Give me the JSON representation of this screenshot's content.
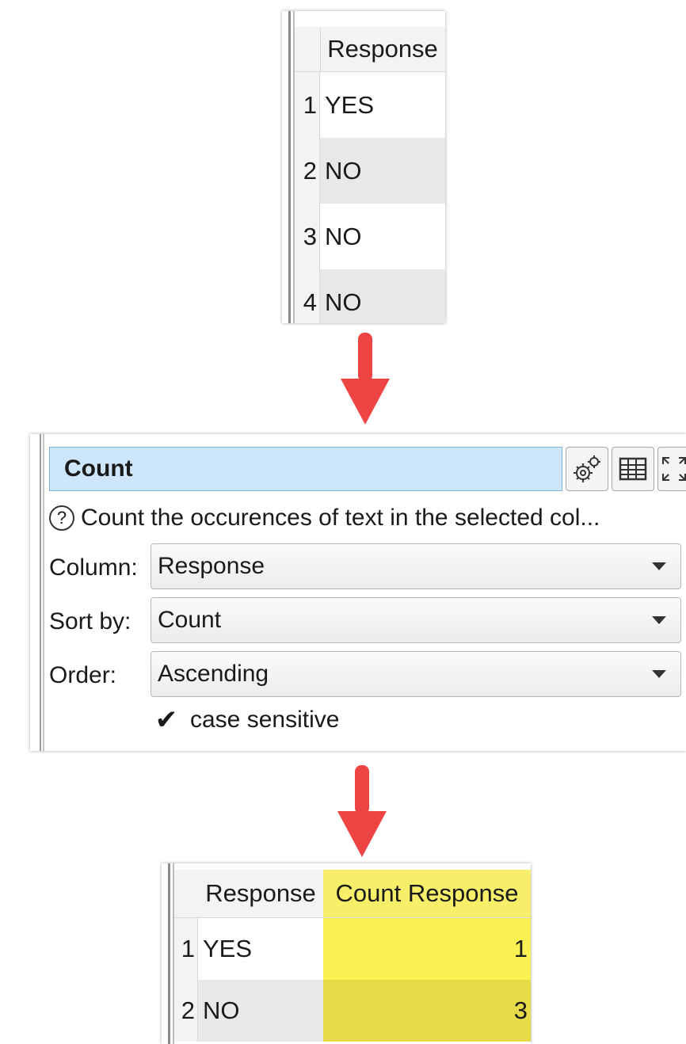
{
  "input_table": {
    "column_header": "Response",
    "rows": [
      {
        "num": "1",
        "value": "YES"
      },
      {
        "num": "2",
        "value": "NO"
      },
      {
        "num": "3",
        "value": "NO"
      },
      {
        "num": "4",
        "value": "NO"
      }
    ]
  },
  "transform": {
    "title": "Count",
    "description": "Count the occurences of text in the selected col...",
    "help_glyph": "?",
    "buttons": [
      "gears-icon",
      "table-icon",
      "maximize-icon"
    ],
    "fields": {
      "column": {
        "label": "Column:",
        "value": "Response"
      },
      "sort_by": {
        "label": "Sort by:",
        "value": "Count"
      },
      "order": {
        "label": "Order:",
        "value": "Ascending"
      }
    },
    "case_sensitive": {
      "label": "case sensitive",
      "checked": true,
      "mark": "✔"
    }
  },
  "output_table": {
    "columns": [
      "Response",
      "Count Response"
    ],
    "rows": [
      {
        "num": "1",
        "response": "YES",
        "count": "1"
      },
      {
        "num": "2",
        "response": "NO",
        "count": "3"
      }
    ],
    "highlight_color": "#fbf152"
  },
  "colors": {
    "arrow": "#ef4444",
    "title_bg": "#cde6fb"
  }
}
